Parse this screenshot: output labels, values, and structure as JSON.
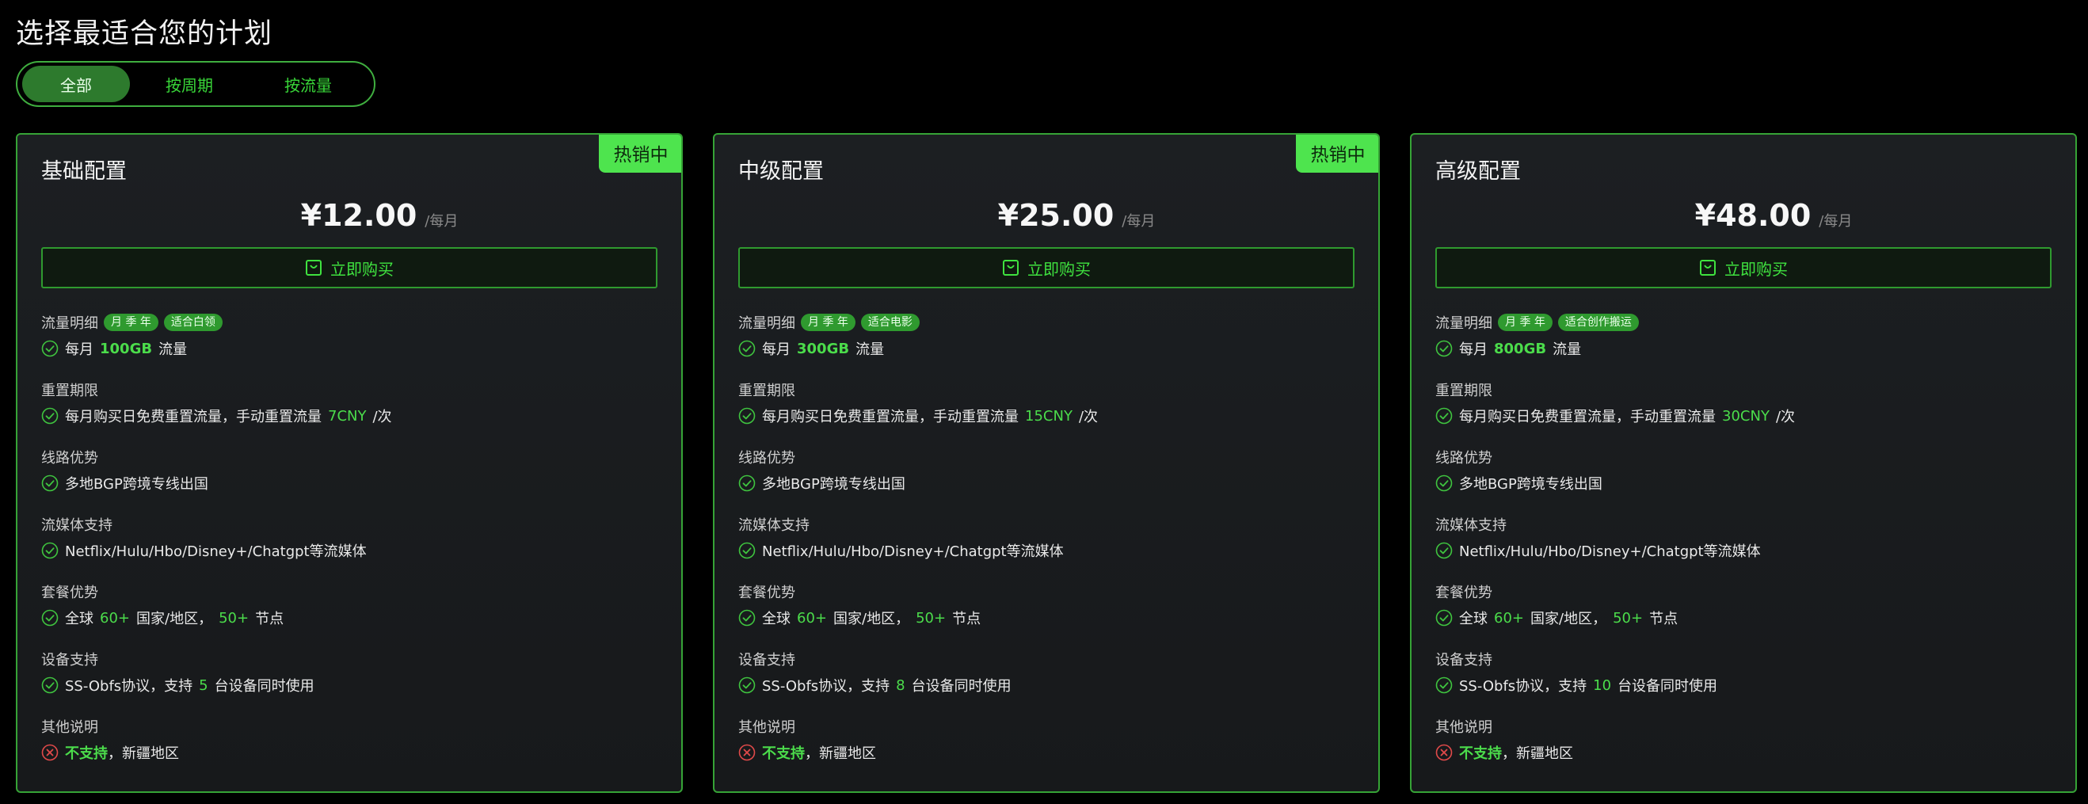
{
  "page": {
    "title": "选择最适合您的计划"
  },
  "tabs": [
    {
      "label": "全部",
      "active": true
    },
    {
      "label": "按周期",
      "active": false
    },
    {
      "label": "按流量",
      "active": false
    }
  ],
  "theme": {
    "accent": "#4ee44e",
    "border": "#36a336",
    "card_bg": "#1c1f22",
    "error": "#e14a4a"
  },
  "labels": {
    "traffic": "流量明细",
    "reset": "重置期限",
    "route": "线路优势",
    "streaming": "流媒体支持",
    "package": "套餐优势",
    "device": "设备支持",
    "other": "其他说明",
    "buy": "立即购买",
    "per_month": "/每月",
    "hot": "热销中",
    "monthly": "每月",
    "traffic_unit": "流量",
    "reset_text": "每月购买日免费重置流量，手动重置流量",
    "reset_suffix": "/次",
    "route_text": "多地BGP跨境专线出国",
    "streaming_text": "Netflix/Hulu/Hbo/Disney+/Chatgpt等流媒体",
    "global": "全球",
    "regions_suffix": "国家/地区，",
    "nodes_suffix": "节点",
    "protocol_prefix": "SS-Obfs协议，支持",
    "protocol_suffix": "台设备同时使用",
    "not_supported": "不支持",
    "not_supported_suffix": "，新疆地区",
    "period_pill": "月 季 年",
    "icons": {
      "check": "check-circle-icon",
      "cross": "x-circle-icon",
      "cart": "shopping-bag-icon"
    }
  },
  "plans": [
    {
      "name": "基础配置",
      "price": "¥12.00",
      "hot": true,
      "use_pill": "适合白领",
      "traffic": "100GB",
      "reset_price": "7CNY",
      "regions": "60+",
      "nodes": "50+",
      "devices": "5"
    },
    {
      "name": "中级配置",
      "price": "¥25.00",
      "hot": true,
      "use_pill": "适合电影",
      "traffic": "300GB",
      "reset_price": "15CNY",
      "regions": "60+",
      "nodes": "50+",
      "devices": "8"
    },
    {
      "name": "高级配置",
      "price": "¥48.00",
      "hot": false,
      "use_pill": "适合创作搬运",
      "traffic": "800GB",
      "reset_price": "30CNY",
      "regions": "60+",
      "nodes": "50+",
      "devices": "10"
    }
  ]
}
